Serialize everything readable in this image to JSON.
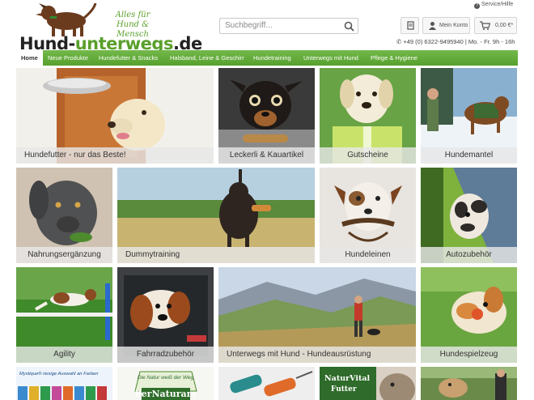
{
  "logo": {
    "brand_dark": "Hund-",
    "brand_green": "unterwegs",
    "brand_tld": ".de",
    "slogan": "Alles für Hund & Mensch"
  },
  "search": {
    "placeholder": "Suchbegriff..."
  },
  "service": {
    "label": "Service/Hilfe"
  },
  "account": {
    "label": "Mein Konto"
  },
  "cart": {
    "amount": "0,00 €",
    "caret": "*"
  },
  "phone": {
    "text": "+49 (0) 6322-9495940 | Mo. - Fr. 9h - 16h"
  },
  "nav": [
    {
      "label": "Home",
      "active": true
    },
    {
      "label": "Neue Produkte"
    },
    {
      "label": "Hundefutter & Snacks"
    },
    {
      "label": "Halsband, Leine & Geschirr"
    },
    {
      "label": "Hundetraining"
    },
    {
      "label": "Unterwegs mit Hund"
    },
    {
      "label": "Pflege & Hygiene"
    }
  ],
  "tiles": [
    {
      "label": "Hundefutter - nur das Beste!"
    },
    {
      "label": "Leckerli & Kauartikel"
    },
    {
      "label": "Gutscheine"
    },
    {
      "label": "Hundemantel"
    },
    {
      "label": "Nahrungsergänzung"
    },
    {
      "label": "Dummytraining"
    },
    {
      "label": "Hundeleinen"
    },
    {
      "label": "Autozubehör"
    },
    {
      "label": "Agility"
    },
    {
      "label": "Fahrradzubehör"
    },
    {
      "label": "Unterwegs mit Hund - Hundeausrüstung"
    },
    {
      "label": "Hundespielzeug"
    },
    {
      "label": "Mystique® riesige Auswahl an Farben"
    },
    {
      "label": "Die Natur weiß der Weg"
    },
    {
      "label": "PerNaturam"
    },
    {
      "label": "NaturVital"
    },
    {
      "label": "Futter"
    }
  ],
  "colors": {
    "nav_green": "#62a93a",
    "brand_green": "#5aa02c",
    "caption_bg": "#e6e6e6"
  }
}
